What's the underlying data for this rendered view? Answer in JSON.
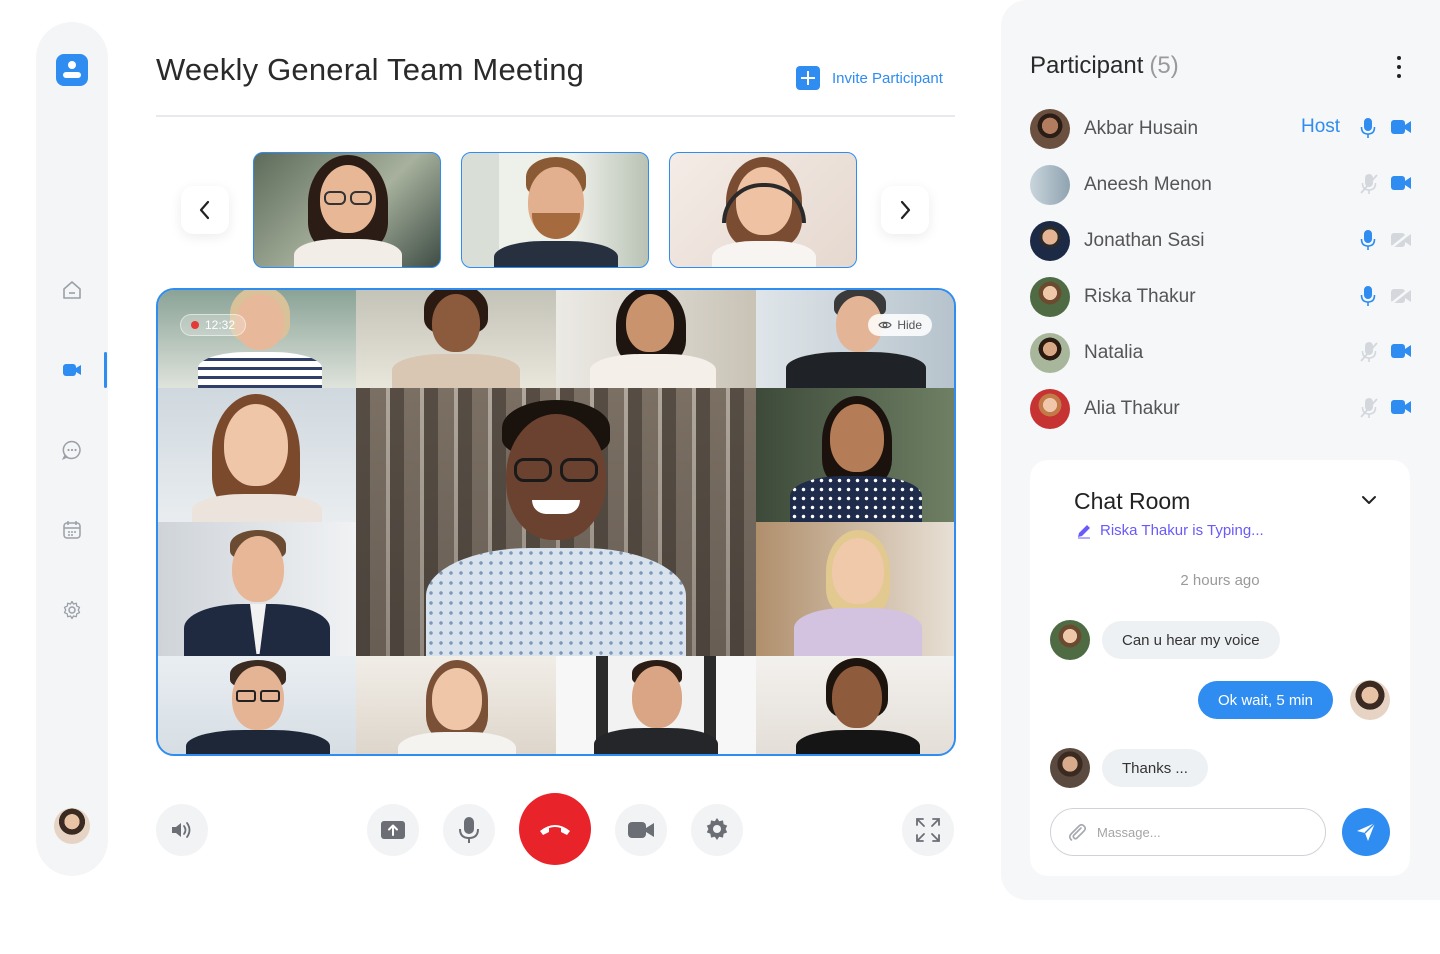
{
  "meeting": {
    "title": "Weekly General Team Meeting",
    "invite_label": "Invite Participant",
    "recording_time": "12:32",
    "hide_label": "Hide"
  },
  "sidebar": {
    "items": [
      {
        "icon": "home-icon"
      },
      {
        "icon": "video-icon",
        "active": true
      },
      {
        "icon": "chat-icon"
      },
      {
        "icon": "calendar-icon"
      },
      {
        "icon": "settings-icon"
      }
    ]
  },
  "controls": [
    "volume-icon",
    "share-screen-icon",
    "microphone-icon",
    "end-call-icon",
    "camera-icon",
    "settings-icon",
    "fullscreen-icon"
  ],
  "participants": {
    "title": "Participant",
    "count": "(5)",
    "list": [
      {
        "name": "Akbar Husain",
        "role": "Host",
        "mic": "on",
        "cam": "on"
      },
      {
        "name": "Aneesh Menon",
        "role": "",
        "mic": "off",
        "cam": "on"
      },
      {
        "name": "Jonathan Sasi",
        "role": "",
        "mic": "on",
        "cam": "off"
      },
      {
        "name": "Riska Thakur",
        "role": "",
        "mic": "on",
        "cam": "off"
      },
      {
        "name": "Natalia",
        "role": "",
        "mic": "off",
        "cam": "on"
      },
      {
        "name": "Alia Thakur",
        "role": "",
        "mic": "off",
        "cam": "on"
      }
    ]
  },
  "chat": {
    "title": "Chat Room",
    "typing": "Riska Thakur is Typing...",
    "time": "2 hours ago",
    "messages": [
      {
        "text": "Can u hear my voice",
        "direction": "in"
      },
      {
        "text": "Ok wait, 5 min",
        "direction": "out"
      },
      {
        "text": "Thanks ...",
        "direction": "in"
      }
    ],
    "placeholder": "Massage..."
  },
  "colors": {
    "accent": "#2f8cf0",
    "danger": "#e8232a",
    "typing": "#6a5af9"
  }
}
